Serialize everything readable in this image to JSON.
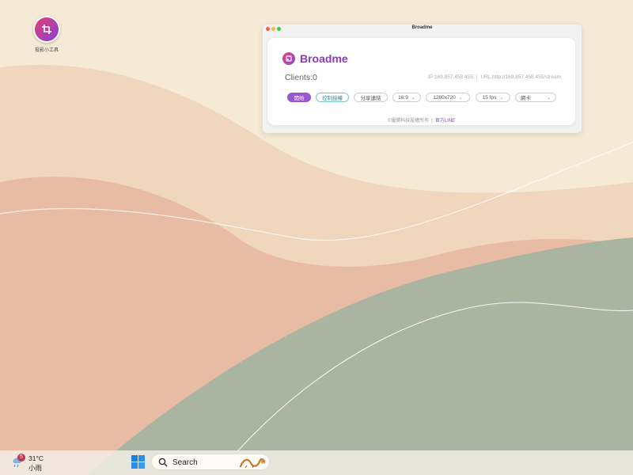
{
  "desktop": {
    "app_icon_label": "投影小工具"
  },
  "window": {
    "title": "Broadme",
    "brand_name": "Broadme",
    "clients": "Clients:0",
    "ip": "IP:169.857.458.455",
    "url": "URL:http://169.857.458.455/stream",
    "buttons": {
      "start": "開始",
      "control": "控制授權",
      "share": "分享連結"
    },
    "selects": {
      "aspect": "16:9",
      "resolution": "1280x720",
      "fps": "15 fps",
      "network": "網卡"
    },
    "footer": {
      "copyright": "©優勝科技股權所有",
      "official_line": "官方LINE"
    }
  },
  "taskbar": {
    "weather": {
      "badge": "5",
      "temperature": "31°C",
      "condition": "小雨"
    },
    "search_label": "Search"
  },
  "colors": {
    "accent": "#9b57d0",
    "brand_text": "#8a3fb0",
    "teal": "#7cc5c9",
    "wallpaper_cream": "#f5e8d3",
    "wallpaper_peach": "#e8b9a0",
    "wallpaper_sage": "#a9b6a1"
  },
  "icons": {
    "desktop_app": "crop-frame-icon",
    "window_logo": "broadcast-logo-icon",
    "weather": "rain-cloud-icon",
    "start": "windows-logo-icon",
    "search": "search-icon",
    "search_art": "dragon-illustration-icon"
  }
}
